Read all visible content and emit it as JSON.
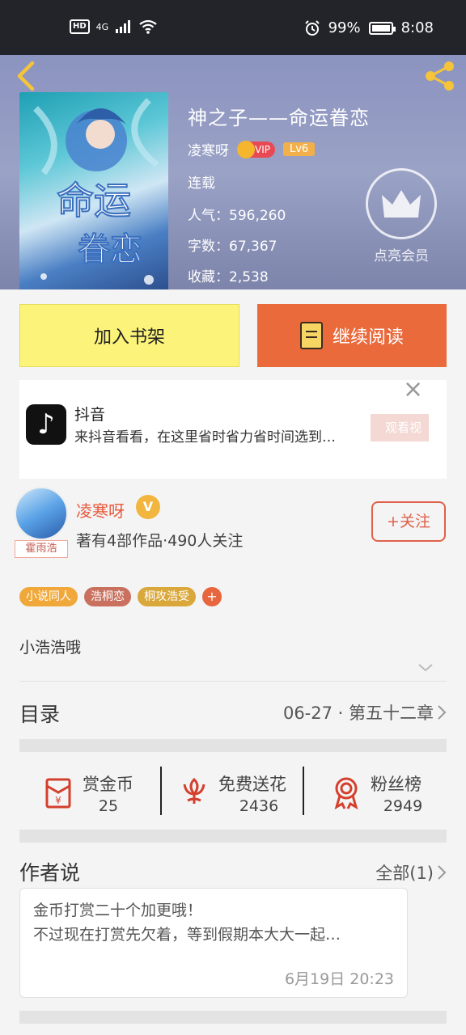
{
  "status_bar": {
    "hd": "HD",
    "signal": "4G",
    "battery": "99%",
    "time": "8:08"
  },
  "book": {
    "title": "神之子——命运眷恋",
    "author": "凌寒呀",
    "vip": "VIP",
    "level": "Lv6",
    "status": "连载",
    "popularity_label": "人气：",
    "popularity": "596,260",
    "words_label": "字数：",
    "words": "67,367",
    "favorites_label": "收藏：",
    "favorites": "2,538",
    "member_label": "点亮会员"
  },
  "actions": {
    "add_shelf": "加入书架",
    "continue_read": "继续阅读"
  },
  "ad": {
    "app": "抖音",
    "desc": "来抖音看看，在这里省时省力省时间选到…",
    "cta": "观看视"
  },
  "author_info": {
    "name": "凌寒呀",
    "verified": "V",
    "avatar_tag": "霍雨浩",
    "stats": "著有4部作品·490人关注",
    "follow": "+关注"
  },
  "tags": [
    {
      "label": "小说同人",
      "color": "#f0a83a"
    },
    {
      "label": "浩桐恋",
      "color": "#c9705e"
    },
    {
      "label": "桐攻浩受",
      "color": "#d9a73a"
    }
  ],
  "tag_more": "+",
  "intro": "小浩浩哦",
  "toc": {
    "label": "目录",
    "latest": "06-27 · 第五十二章"
  },
  "rewards": [
    {
      "label": "赏金币",
      "count": "25"
    },
    {
      "label": "免费送花",
      "count": "2436"
    },
    {
      "label": "粉丝榜",
      "count": "2949"
    }
  ],
  "author_says": {
    "title": "作者说",
    "all": "全部(1)",
    "line1": "金币打赏二十个加更哦！",
    "line2": "不过现在打赏先欠着，等到假期本大大一起…",
    "timestamp": "6月19日  20:23"
  }
}
